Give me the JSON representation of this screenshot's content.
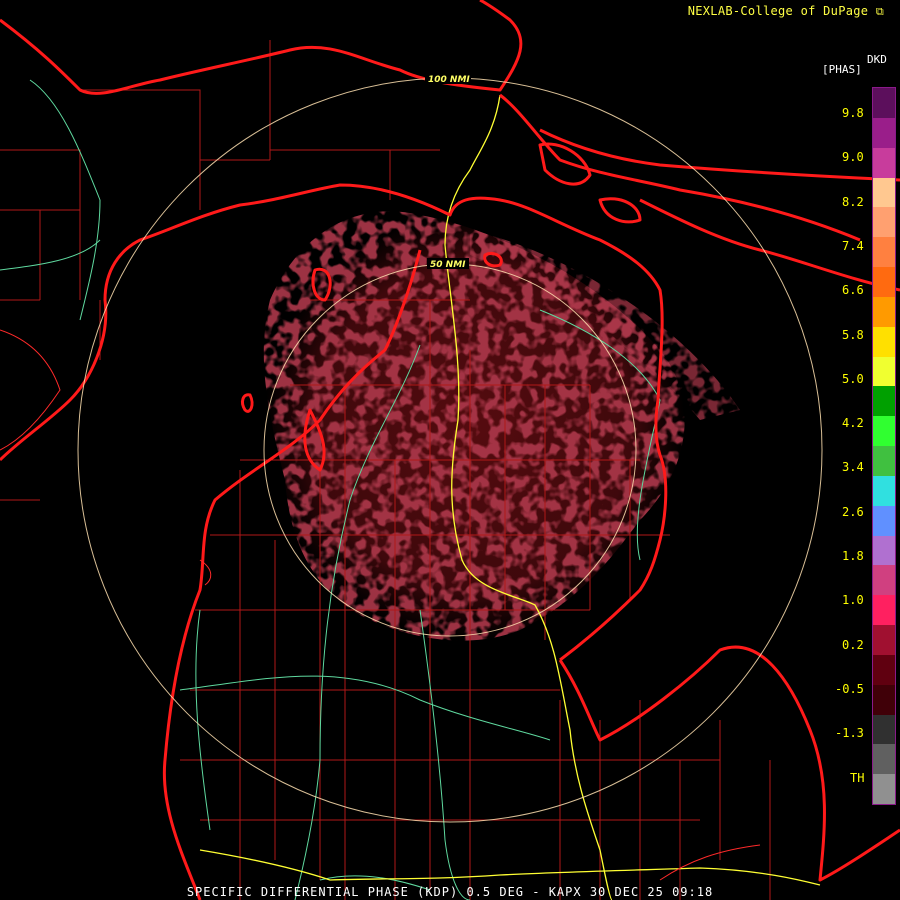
{
  "credit": "NEXLAB-College of DuPage",
  "legend": {
    "product": "DKD",
    "units": "[PHAS]",
    "ticks": [
      "9.8",
      "9.0",
      "8.2",
      "7.4",
      "6.6",
      "5.8",
      "5.0",
      "4.2",
      "3.4",
      "2.6",
      "1.8",
      "1.0",
      "0.2",
      "-0.5",
      "-1.3",
      "TH"
    ],
    "colors": [
      "#5c0f5c",
      "#9a1e8a",
      "#c83c9c",
      "#ffc890",
      "#ffa070",
      "#ff8040",
      "#ff6a10",
      "#ff9a00",
      "#ffe000",
      "#f0ff30",
      "#00a000",
      "#30ff30",
      "#40c040",
      "#30e0e0",
      "#6090ff",
      "#b070d0",
      "#d04080",
      "#ff2060",
      "#a01030",
      "#600010",
      "#400008",
      "#303030",
      "#606060",
      "#909090"
    ]
  },
  "range_rings": [
    "100 NMI",
    "50 NMI"
  ],
  "product_line": "SPECIFIC DIFFERENTIAL PHASE (KDP) 0.5 DEG - KAPX 30 DEC 25 09:18",
  "colors": {
    "coastline": "#ff1a1a",
    "county": "#b01818",
    "highway": "#ffff33",
    "road": "#5fd99f",
    "ring": "#ffe0b0",
    "echo": "#5a0c10"
  }
}
